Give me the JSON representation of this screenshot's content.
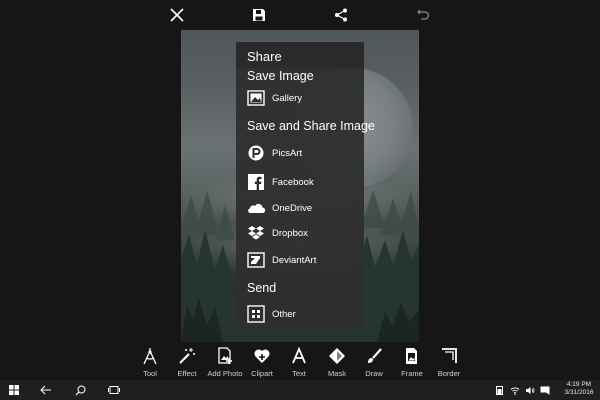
{
  "top_bar": {
    "close_icon": "close-icon",
    "save_icon": "save-icon",
    "share_icon": "share-icon",
    "undo_icon": "undo-icon"
  },
  "share_panel": {
    "title": "Share",
    "save_image_label": "Save Image",
    "save_items": [
      {
        "label": "Gallery",
        "icon": "gallery-icon"
      }
    ],
    "save_share_label": "Save and Share Image",
    "share_items": [
      {
        "label": "PicsArt",
        "icon": "picsart-icon"
      },
      {
        "label": "Facebook",
        "icon": "facebook-icon"
      },
      {
        "label": "OneDrive",
        "icon": "onedrive-icon"
      },
      {
        "label": "Dropbox",
        "icon": "dropbox-icon"
      },
      {
        "label": "DeviantArt",
        "icon": "deviantart-icon"
      }
    ],
    "send_label": "Send",
    "send_items": [
      {
        "label": "Other",
        "icon": "other-icon"
      }
    ]
  },
  "toolbar": {
    "tools": [
      {
        "label": "Tool",
        "icon": "compass-icon"
      },
      {
        "label": "Effect",
        "icon": "magic-wand-icon"
      },
      {
        "label": "Add Photo",
        "icon": "add-photo-icon"
      },
      {
        "label": "Clipart",
        "icon": "clipart-heart-icon"
      },
      {
        "label": "Text",
        "icon": "text-icon"
      },
      {
        "label": "Mask",
        "icon": "mask-icon"
      },
      {
        "label": "Draw",
        "icon": "brush-icon"
      },
      {
        "label": "Frame",
        "icon": "frame-icon"
      },
      {
        "label": "Border",
        "icon": "border-icon"
      }
    ]
  },
  "taskbar": {
    "time": "4:19 PM",
    "date": "3/31/2016"
  },
  "colors": {
    "background": "#161616",
    "panel": "#2e2e2e",
    "panel_header": "#2b2b2b",
    "facebook": "#3b5998"
  }
}
